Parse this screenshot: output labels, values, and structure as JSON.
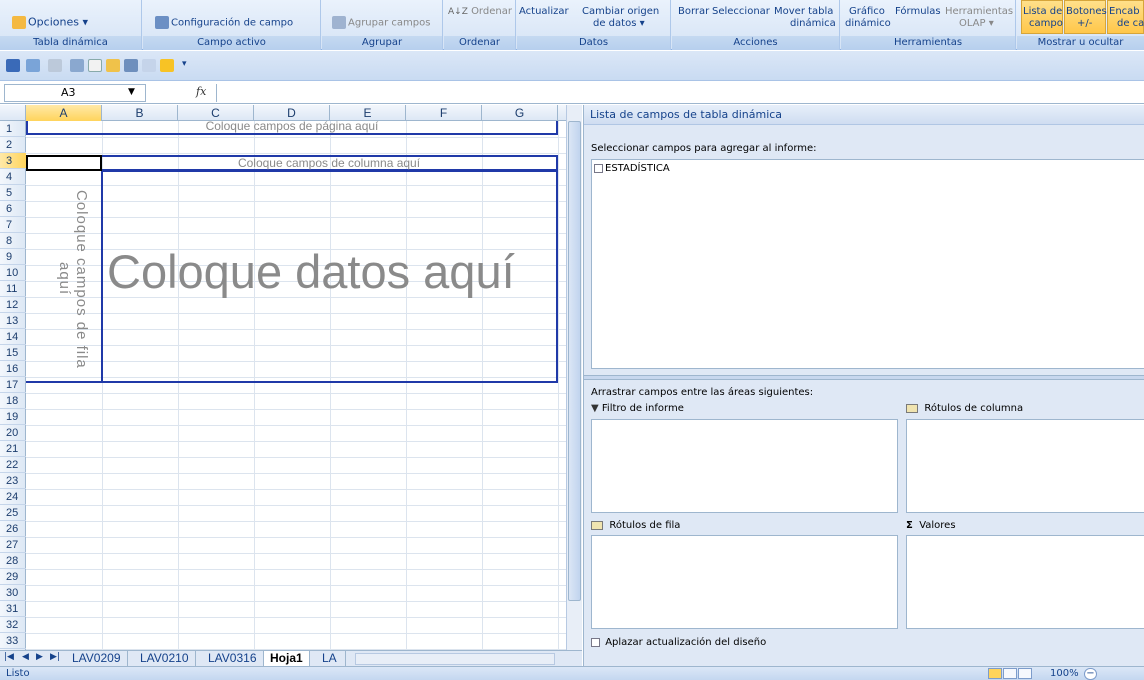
{
  "ribbon": {
    "groups": [
      {
        "label": "Tabla dinámica",
        "buttons": [
          "Opciones ▾"
        ]
      },
      {
        "label": "Campo activo",
        "buttons": [
          "Configuración de campo"
        ]
      },
      {
        "label": "Agrupar",
        "buttons": [
          "Agrupar campos"
        ]
      },
      {
        "label": "Ordenar",
        "buttons": [
          "Ordenar"
        ]
      },
      {
        "label": "Datos",
        "buttons": [
          "Actualizar",
          "Cambiar origen",
          "de datos ▾"
        ]
      },
      {
        "label": "Acciones",
        "buttons": [
          "Borrar",
          "Seleccionar",
          "Mover tabla",
          "dinámica"
        ]
      },
      {
        "label": "Herramientas",
        "buttons": [
          "Gráfico",
          "dinámico",
          "Fórmulas",
          "Herramientas",
          "OLAP ▾"
        ]
      },
      {
        "label": "Mostrar u ocultar",
        "buttons": [
          "Lista de",
          "campo",
          "Botones",
          "+/-",
          "Encab",
          "de ca"
        ]
      }
    ]
  },
  "formula_bar": {
    "name_box": "A3",
    "fx": "fx",
    "formula": ""
  },
  "sheet": {
    "columns": [
      "A",
      "B",
      "C",
      "D",
      "E",
      "F",
      "G"
    ],
    "rows": [
      "1",
      "2",
      "3",
      "4",
      "5",
      "6",
      "7",
      "8",
      "9",
      "10",
      "11",
      "12",
      "13",
      "14",
      "15",
      "16",
      "17",
      "18",
      "19",
      "20",
      "21",
      "22",
      "23",
      "24",
      "25",
      "26",
      "27",
      "28",
      "29",
      "30",
      "31",
      "32",
      "33"
    ],
    "page_area": "Coloque campos de página aquí",
    "column_area": "Coloque campos de columna aquí",
    "row_area": "Coloque campos de fila aquí",
    "data_area": "Coloque datos aquí"
  },
  "tabs": {
    "items": [
      "LAV0209",
      "LAV0210",
      "LAV0316",
      "Hoja1",
      "LA"
    ],
    "active": "Hoja1"
  },
  "status": {
    "text": "Listo",
    "zoom": "100%"
  },
  "pivot_pane": {
    "title": "Lista de campos de tabla dinámica",
    "choose_fields": "Seleccionar campos para agregar al informe:",
    "fields": [
      "ESTADÍSTICA"
    ],
    "drag_hint": "Arrastrar campos entre las áreas siguientes:",
    "areas": {
      "report_filter": "Filtro de informe",
      "column_labels": "Rótulos de columna",
      "row_labels": "Rótulos de fila",
      "values": "Valores"
    },
    "defer_update": "Aplazar actualización del diseño"
  },
  "colors": {
    "accent": "#15428b",
    "pivot_border": "#2039a8",
    "selected": "#ffd45c"
  }
}
